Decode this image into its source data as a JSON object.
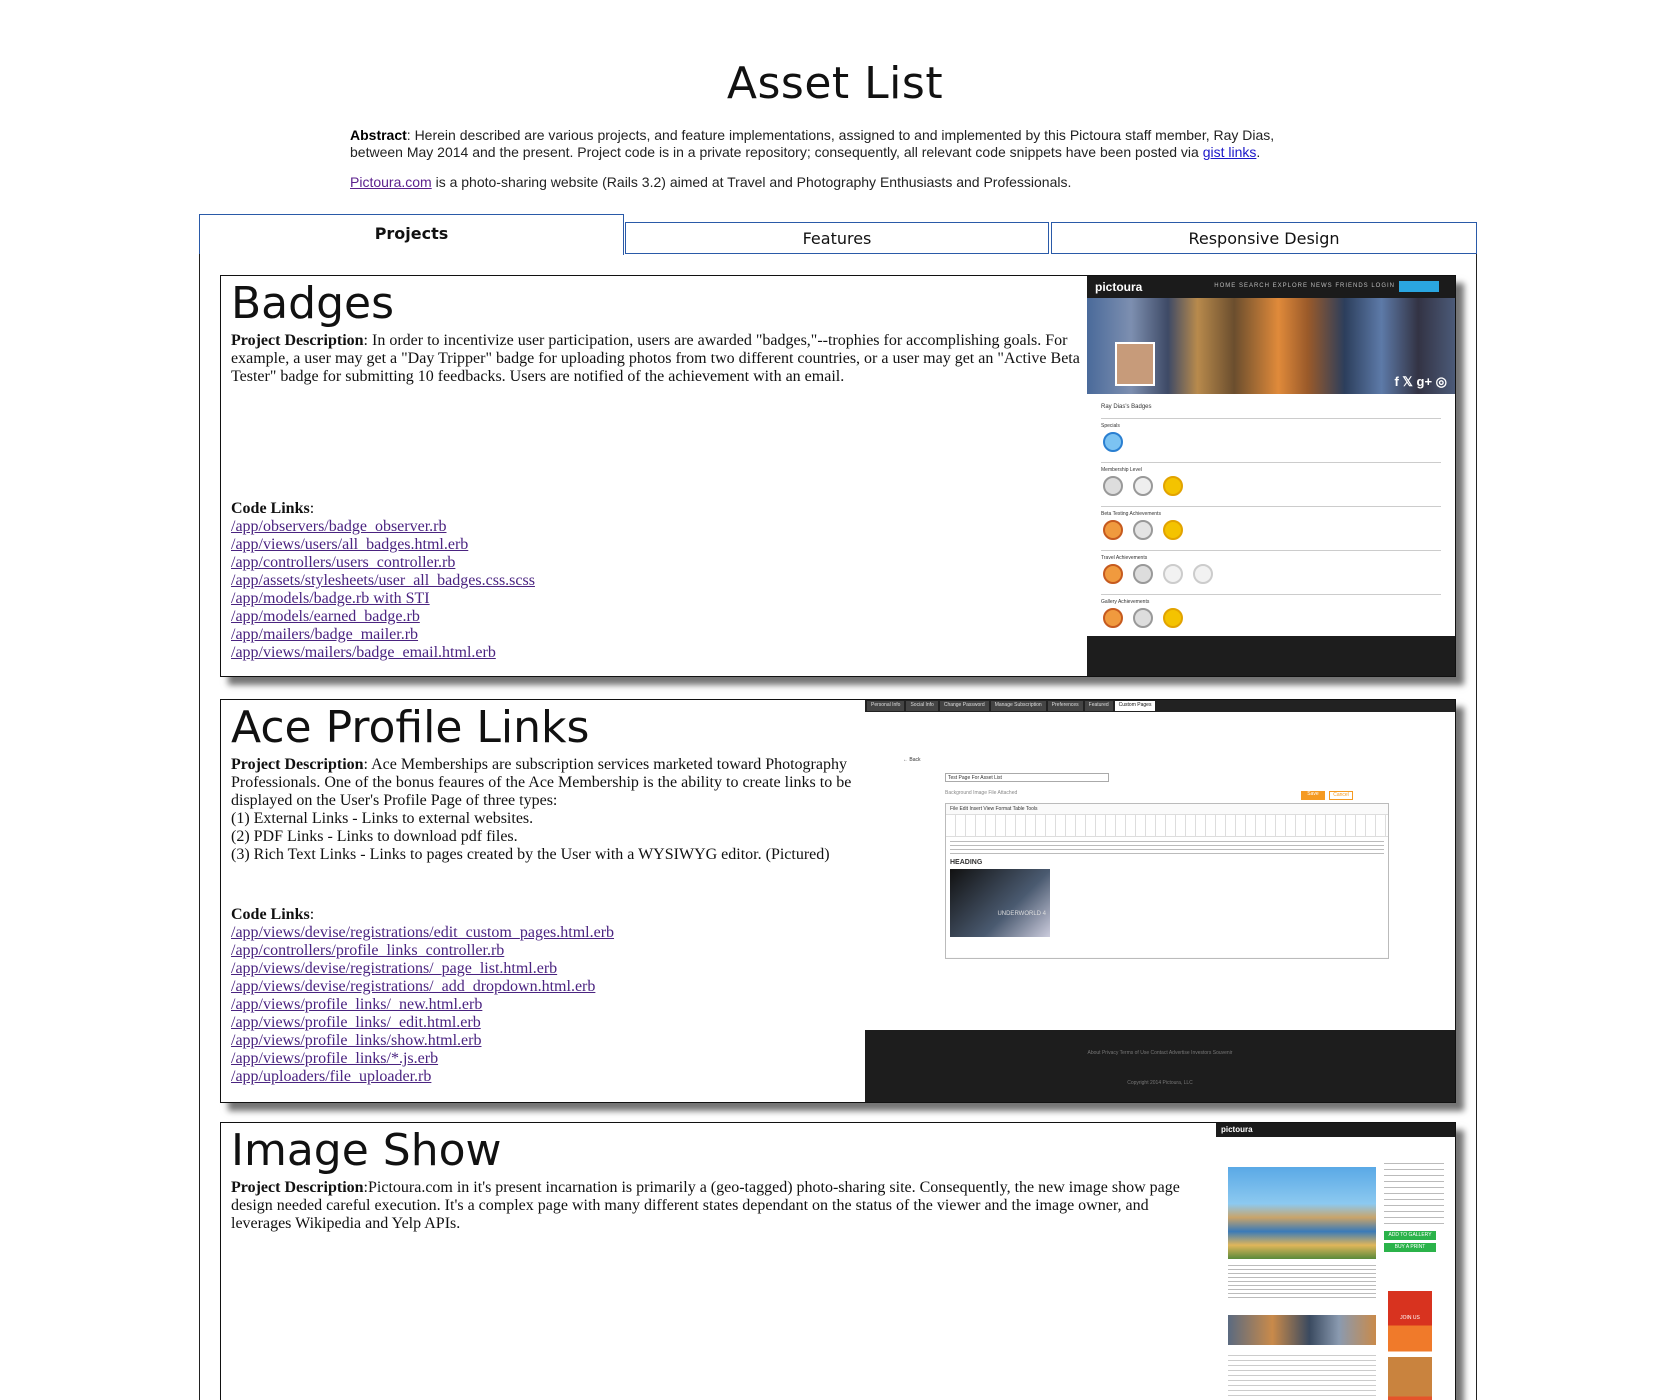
{
  "page": {
    "title": "Asset List"
  },
  "intro": {
    "abstract_label": "Abstract",
    "abstract_text": ": Herein described are various projects, and feature implementations, assigned to and implemented by this Pictoura staff member, Ray Dias, between May 2014 and the present. Project code is in a private repository; consequently, all relevant code snippets have been posted via ",
    "gist_link": "gist links",
    "abstract_end": ".",
    "site_link": "Pictoura.com",
    "site_text": " is a photo-sharing website (Rails 3.2) aimed at Travel and Photography Enthusiasts and Professionals."
  },
  "tabs": [
    {
      "label": "Projects",
      "active": true
    },
    {
      "label": "Features",
      "active": false
    },
    {
      "label": "Responsive Design",
      "active": false
    }
  ],
  "projects": [
    {
      "title": "Badges",
      "desc_label": "Project Description",
      "desc_text": ": In order to incentivize user participation, users are awarded \"badges,\"--trophies for accomplishing goals. For example, a user may get a \"Day Tripper\" badge for uploading photos from two different countries, or a user may get an \"Active Beta Tester\" badge for submitting 10 feedbacks. Users are notified of the achievement with an email.",
      "code_label": "Code Links",
      "links": [
        "/app/observers/badge_observer.rb",
        "/app/views/users/all_badges.html.erb",
        "/app/controllers/users_controller.rb",
        "/app/assets/stylesheets/user_all_badges.css.scss",
        "/app/models/badge.rb with STI",
        "/app/models/earned_badge.rb",
        "/app/mailers/badge_mailer.rb",
        "/app/views/mailers/badge_email.html.erb"
      ]
    },
    {
      "title": "Ace Profile Links",
      "desc_label": "Project Description",
      "desc_text": ": Ace Memberships are subscription services marketed toward Photography Professionals. One of the bonus feaures of the Ace Membership is the ability to create links to be displayed on the User's Profile Page of three types:",
      "desc_lines": [
        "(1) External Links - Links to external websites.",
        "(2) PDF Links - Links to download pdf files.",
        "(3) Rich Text Links - Links to pages created by the User with a WYSIWYG editor. (Pictured)"
      ],
      "code_label": "Code Links",
      "links": [
        "/app/views/devise/registrations/edit_custom_pages.html.erb",
        "/app/controllers/profile_links_controller.rb",
        "/app/views/devise/registrations/_page_list.html.erb",
        "/app/views/devise/registrations/_add_dropdown.html.erb",
        "/app/views/profile_links/_new.html.erb",
        "/app/views/profile_links/_edit.html.erb",
        "/app/views/profile_links/show.html.erb",
        "/app/views/profile_links/*.js.erb",
        "/app/uploaders/file_uploader.rb"
      ]
    },
    {
      "title": "Image Show",
      "desc_label": "Project Description",
      "desc_text": ":Pictoura.com in it's present incarnation is primarily a (geo-tagged) photo-sharing site. Consequently, the new image show page design needed careful execution. It's a complex page with many different states dependant on the status of the viewer and the image owner, and leverages Wikipedia and Yelp APIs."
    }
  ],
  "shots": {
    "badges": {
      "logo": "pictoura",
      "nav": "HOME  SEARCH  EXPLORE  NEWS  FRIENDS  LOGIN",
      "badges_heading": "Ray Dias's Badges",
      "sections": [
        "Specials",
        "Membership Level",
        "Beta Testing Achievements",
        "Travel Achievements",
        "Gallery Achievements"
      ]
    },
    "editor": {
      "tabs": [
        "Personal Info",
        "Social Info",
        "Change Password",
        "Manage Subscription",
        "Preferences",
        "Featured",
        "Custom Pages"
      ],
      "back": "Back",
      "page_title_value": "Test Page For Asset List",
      "bg_label": "Background Image File Attached",
      "save": "Save",
      "cancel": "Cancel",
      "menu": "File  Edit  Insert  View  Format  Table  Tools",
      "heading": "HEADING",
      "poster": "UNDERWORLD 4",
      "footer": "About    Privacy    Terms of Use    Contact    Advertise    Investors    Souvenir",
      "copyright": "Copyright 2014 Pictoura, LLC"
    },
    "imageshow": {
      "logo": "pictoura",
      "add_gallery": "ADD TO GALLERY",
      "buy_print": "BUY A PRINT",
      "join": "JOIN US"
    }
  }
}
